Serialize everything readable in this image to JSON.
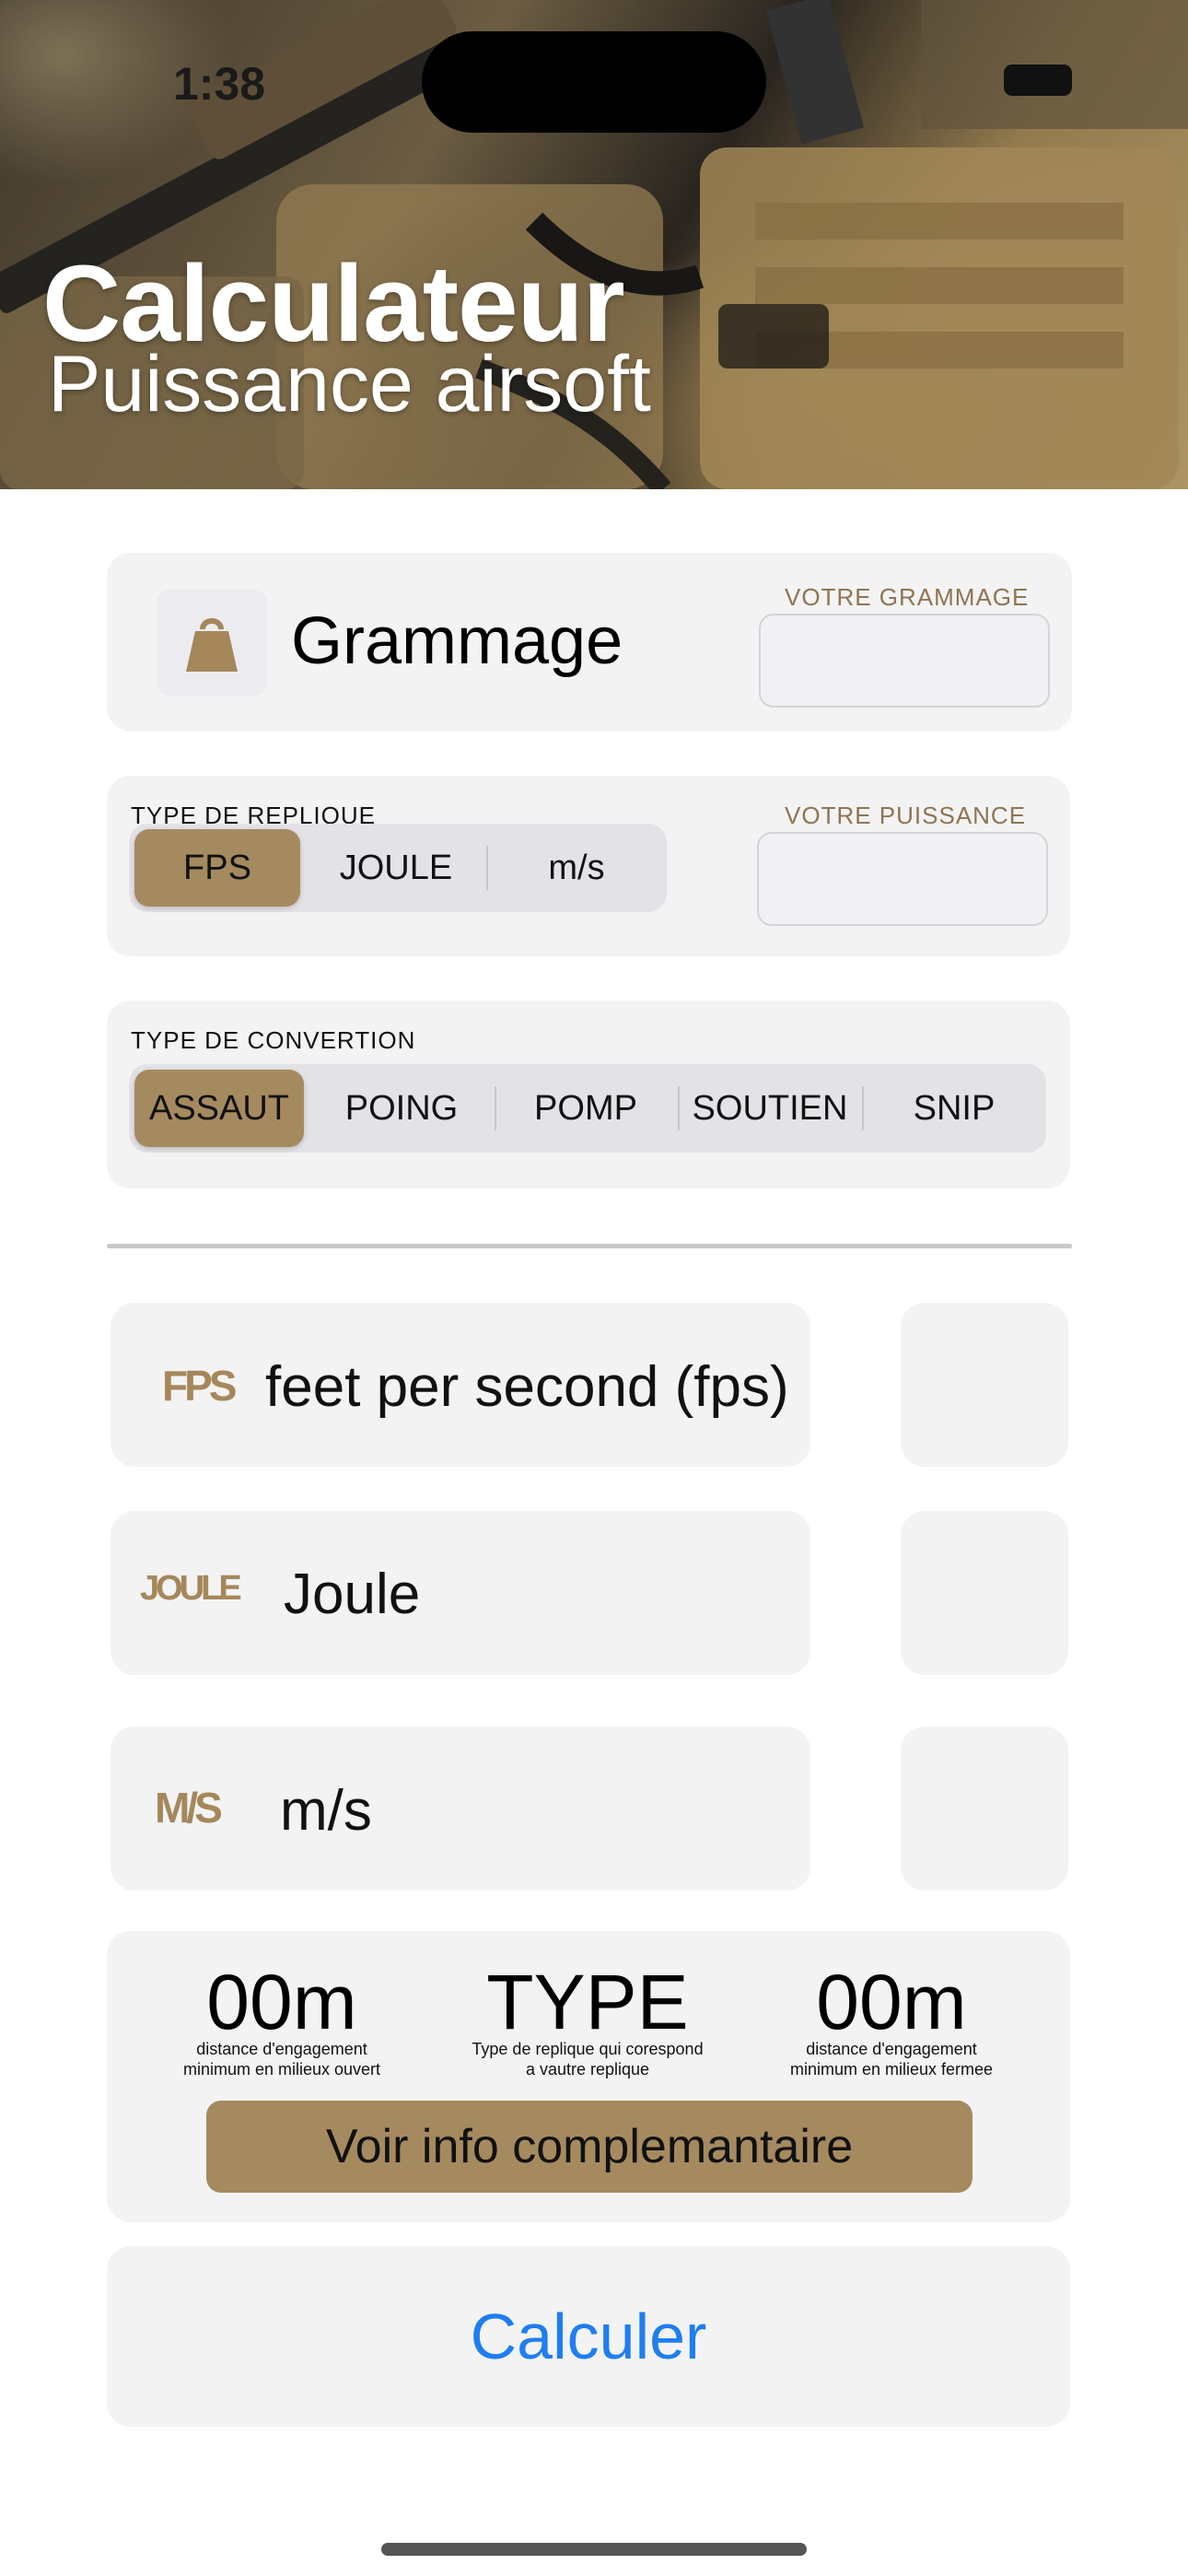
{
  "status_bar": {
    "time": "1:38"
  },
  "hero": {
    "title": "Calculateur",
    "subtitle": "Puissance airsoft"
  },
  "grammage": {
    "icon": "weight-icon",
    "label": "Grammage",
    "input_caption": "VOTRE GRAMMAGE",
    "input_value": ""
  },
  "replica_type": {
    "caption": "TYPE DE REPLIQUE",
    "options": [
      "FPS",
      "JOULE",
      "m/s"
    ],
    "selected": "FPS",
    "power_caption": "VOTRE PUISSANCE",
    "power_value": ""
  },
  "conversion_type": {
    "caption": "TYPE DE CONVERTION",
    "options": [
      "ASSAUT",
      "POING",
      "POMP",
      "SOUTIEN",
      "SNIP"
    ],
    "selected": "ASSAUT"
  },
  "units": [
    {
      "badge": "FPS",
      "label": "feet per second (fps)",
      "value": ""
    },
    {
      "badge": "JOULE",
      "label": "Joule",
      "value": ""
    },
    {
      "badge": "M/S",
      "label": "m/s",
      "value": ""
    }
  ],
  "results": {
    "open_distance": "00m",
    "open_caption_line1": "distance d'engagement",
    "open_caption_line2": "minimum en milieux ouvert",
    "type": "TYPE",
    "type_caption_line1": "Type de replique qui corespond",
    "type_caption_line2": "a vautre replique",
    "closed_distance": "00m",
    "closed_caption_line1": "distance d'engagement",
    "closed_caption_line2": "minimum en milieux fermee",
    "info_button": "Voir info complemantaire"
  },
  "calculate_button": "Calculer",
  "colors": {
    "accent_gold": "#a68a5f",
    "caption_gold": "#8e7452",
    "link_blue": "#1f7ef0",
    "card_bg": "#f3f3f3"
  }
}
